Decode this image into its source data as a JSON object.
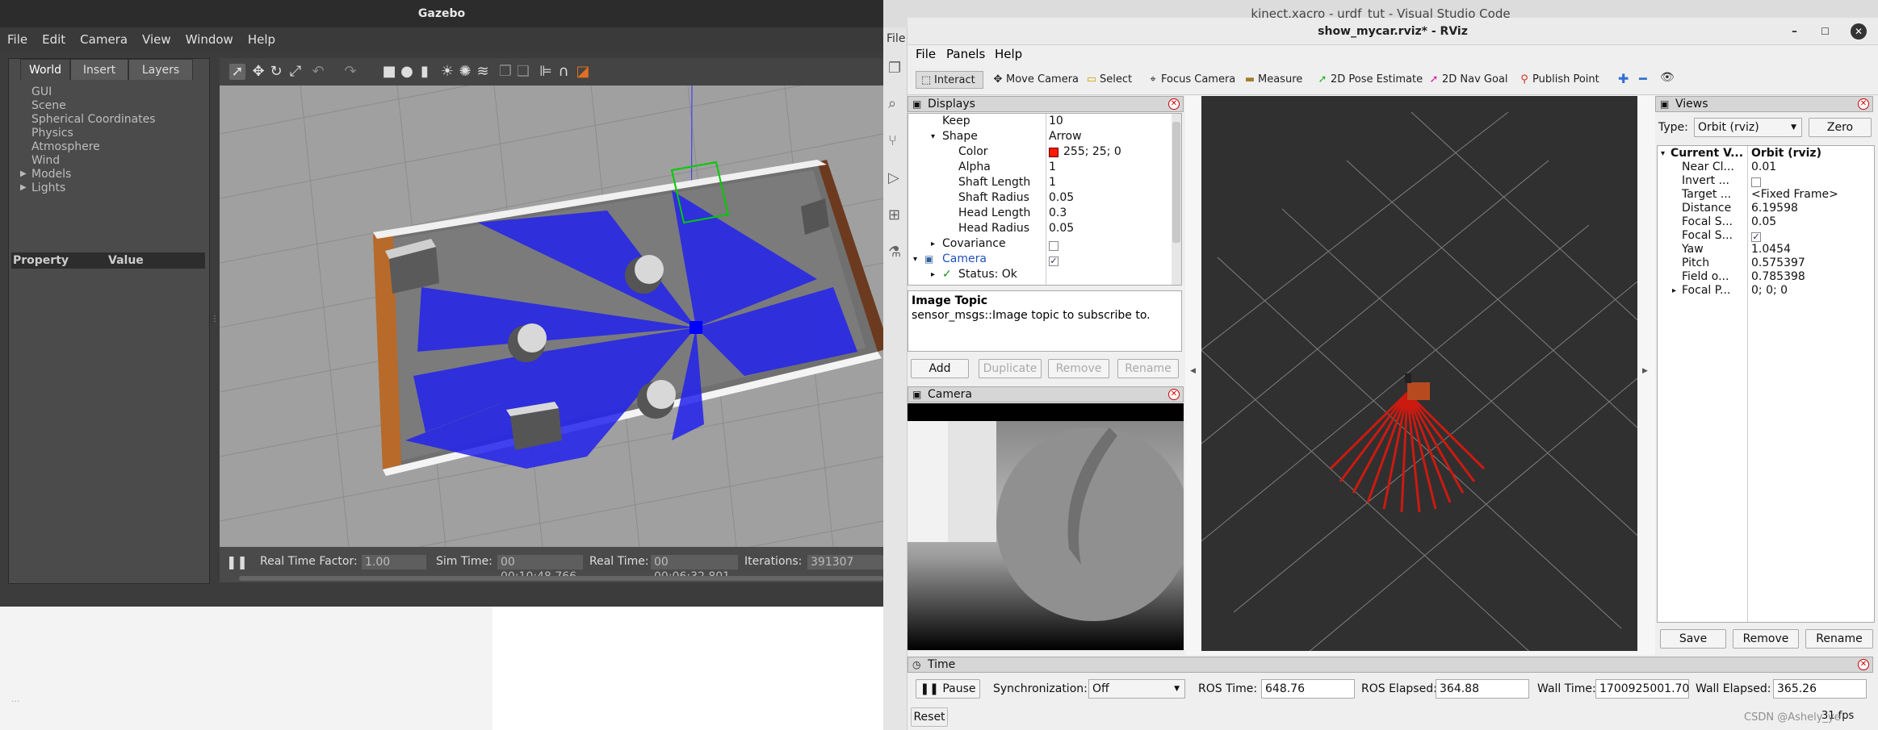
{
  "gazebo": {
    "title": "Gazebo",
    "menu": [
      "File",
      "Edit",
      "Camera",
      "View",
      "Window",
      "Help"
    ],
    "tabs": [
      "World",
      "Insert",
      "Layers"
    ],
    "tree": [
      "GUI",
      "Scene",
      "Spherical Coordinates",
      "Physics",
      "Atmosphere",
      "Wind",
      "Models",
      "Lights"
    ],
    "prop_header": {
      "property": "Property",
      "value": "Value"
    },
    "status": {
      "rtf_label": "Real Time Factor:",
      "rtf": "1.00",
      "sim_label": "Sim Time:",
      "sim": "00 00:10:48.766",
      "real_label": "Real Time:",
      "real": "00 00:06:32.801",
      "iter_label": "Iterations:",
      "iter": "391307"
    }
  },
  "vscode": {
    "title": "kinect.xacro - urdf_tut - Visual Studio Code",
    "file_tab": "File"
  },
  "rviz": {
    "title": "show_mycar.rviz* - RViz",
    "menu": [
      "File",
      "Panels",
      "Help"
    ],
    "toolbar": [
      "Interact",
      "Move Camera",
      "Select",
      "Focus Camera",
      "Measure",
      "2D Pose Estimate",
      "2D Nav Goal",
      "Publish Point"
    ],
    "displays": {
      "title": "Displays",
      "rows": [
        {
          "k": "Keep",
          "v": "10"
        },
        {
          "k": "Shape",
          "v": "Arrow"
        },
        {
          "k": "Color",
          "v": "255; 25; 0"
        },
        {
          "k": "Alpha",
          "v": "1"
        },
        {
          "k": "Shaft Length",
          "v": "1"
        },
        {
          "k": "Shaft Radius",
          "v": "0.05"
        },
        {
          "k": "Head Length",
          "v": "0.3"
        },
        {
          "k": "Head Radius",
          "v": "0.05"
        },
        {
          "k": "Covariance",
          "v": ""
        },
        {
          "k": "Camera",
          "v": ""
        },
        {
          "k": "Status: Ok",
          "v": ""
        }
      ],
      "desc_title": "Image Topic",
      "desc_text": "sensor_msgs::Image topic to subscribe to.",
      "buttons": [
        "Add",
        "Duplicate",
        "Remove",
        "Rename"
      ]
    },
    "camera_panel": {
      "title": "Camera"
    },
    "views": {
      "title": "Views",
      "type_label": "Type:",
      "type_value": "Orbit (rviz)",
      "zero": "Zero",
      "header_k": "Current V...",
      "header_v": "Orbit (rviz)",
      "rows": [
        {
          "k": "Near Cl...",
          "v": "0.01"
        },
        {
          "k": "Invert ...",
          "v": ""
        },
        {
          "k": "Target ...",
          "v": "<Fixed Frame>"
        },
        {
          "k": "Distance",
          "v": "6.19598"
        },
        {
          "k": "Focal S...",
          "v": "0.05"
        },
        {
          "k": "Focal S...",
          "v": ""
        },
        {
          "k": "Yaw",
          "v": "1.0454"
        },
        {
          "k": "Pitch",
          "v": "0.575397"
        },
        {
          "k": "Field o...",
          "v": "0.785398"
        },
        {
          "k": "Focal P...",
          "v": "0; 0; 0"
        }
      ],
      "buttons": [
        "Save",
        "Remove",
        "Rename"
      ]
    },
    "time": {
      "title": "Time",
      "pause": "Pause",
      "sync_label": "Synchronization:",
      "sync_value": "Off",
      "ros_time_label": "ROS Time:",
      "ros_time": "648.76",
      "ros_elapsed_label": "ROS Elapsed:",
      "ros_elapsed": "364.88",
      "wall_time_label": "Wall Time:",
      "wall_time": "1700925001.70",
      "wall_elapsed_label": "Wall Elapsed:",
      "wall_elapsed": "365.26",
      "reset": "Reset",
      "fps": "31 fps"
    }
  },
  "watermark": "CSDN @Ashely_ye",
  "misc_text": "...",
  "colors": {
    "laser_blue": "#1a1aff",
    "arrow_red": "#cc1a10"
  }
}
